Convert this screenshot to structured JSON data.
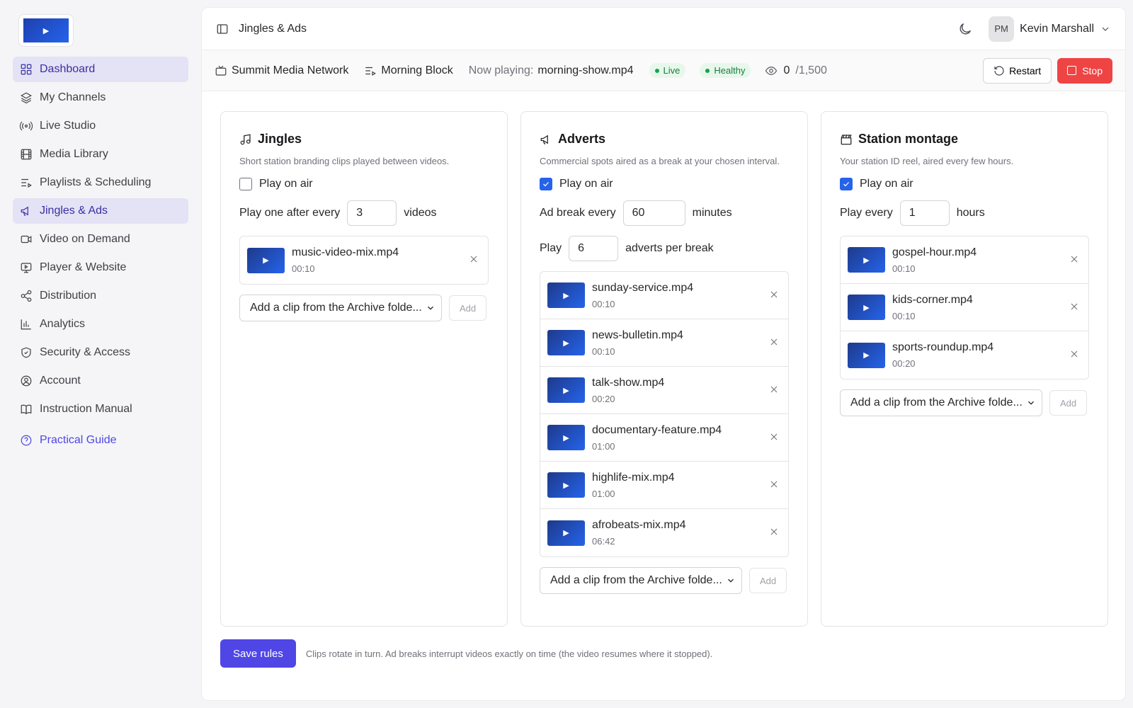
{
  "sidebar": {
    "logo_icon": "play-logo",
    "items": [
      {
        "label": "Dashboard",
        "icon": "grid-icon"
      },
      {
        "label": "My Channels",
        "icon": "layers-icon"
      },
      {
        "label": "Live Studio",
        "icon": "broadcast-icon"
      },
      {
        "label": "Media Library",
        "icon": "film-icon"
      },
      {
        "label": "Playlists & Scheduling",
        "icon": "playlist-icon"
      },
      {
        "label": "Jingles & Ads",
        "icon": "megaphone-icon"
      },
      {
        "label": "Video on Demand",
        "icon": "video-icon"
      },
      {
        "label": "Player & Website",
        "icon": "monitor-icon"
      },
      {
        "label": "Distribution",
        "icon": "share-icon"
      },
      {
        "label": "Analytics",
        "icon": "chart-icon"
      },
      {
        "label": "Security & Access",
        "icon": "shield-icon"
      },
      {
        "label": "Account",
        "icon": "user-circle-icon"
      },
      {
        "label": "Instruction Manual",
        "icon": "book-icon"
      }
    ],
    "guide_label": "Practical Guide",
    "accent": "#4f46e5"
  },
  "header": {
    "title": "Jingles & Ads",
    "avatar_initials": "PM",
    "user_name": "Kevin Marshall"
  },
  "status": {
    "network": "Summit Media Network",
    "block": "Morning Block",
    "now_playing_label": "Now playing:",
    "now_playing": "morning-show.mp4",
    "live_badge": "Live",
    "health_badge": "Healthy",
    "viewers": "0",
    "viewers_max": "/1,500",
    "restart_label": "Restart",
    "stop_label": "Stop",
    "stop_color": "#ef4444"
  },
  "jingles": {
    "title": "Jingles",
    "desc": "Short station branding clips played between videos.",
    "play_on_air_label": "Play on air",
    "play_on_air": false,
    "rule_prefix": "Play one after every",
    "rule_value": "3",
    "rule_suffix": "videos",
    "clips": [
      {
        "name": "music-video-mix.mp4",
        "duration": "00:10"
      }
    ],
    "select_label": "Add a clip from the Archive folde...",
    "add_label": "Add"
  },
  "adverts": {
    "title": "Adverts",
    "desc": "Commercial spots aired as a break at your chosen interval.",
    "play_on_air_label": "Play on air",
    "play_on_air": true,
    "rule1_prefix": "Ad break every",
    "rule1_value": "60",
    "rule1_suffix": "minutes",
    "rule2_prefix": "Play",
    "rule2_value": "6",
    "rule2_suffix": "adverts per break",
    "clips": [
      {
        "name": "sunday-service.mp4",
        "duration": "00:10"
      },
      {
        "name": "news-bulletin.mp4",
        "duration": "00:10"
      },
      {
        "name": "talk-show.mp4",
        "duration": "00:20"
      },
      {
        "name": "documentary-feature.mp4",
        "duration": "01:00"
      },
      {
        "name": "highlife-mix.mp4",
        "duration": "01:00"
      },
      {
        "name": "afrobeats-mix.mp4",
        "duration": "06:42"
      }
    ],
    "select_label": "Add a clip from the Archive folde...",
    "add_label": "Add"
  },
  "montage": {
    "title": "Station montage",
    "desc": "Your station ID reel, aired every few hours.",
    "play_on_air_label": "Play on air",
    "play_on_air": true,
    "rule_prefix": "Play every",
    "rule_value": "1",
    "rule_suffix": "hours",
    "clips": [
      {
        "name": "gospel-hour.mp4",
        "duration": "00:10"
      },
      {
        "name": "kids-corner.mp4",
        "duration": "00:10"
      },
      {
        "name": "sports-roundup.mp4",
        "duration": "00:20"
      }
    ],
    "select_label": "Add a clip from the Archive folde...",
    "add_label": "Add"
  },
  "footer": {
    "save_label": "Save rules",
    "note": "Clips rotate in turn. Ad breaks interrupt videos exactly on time (the video resumes where it stopped)."
  }
}
